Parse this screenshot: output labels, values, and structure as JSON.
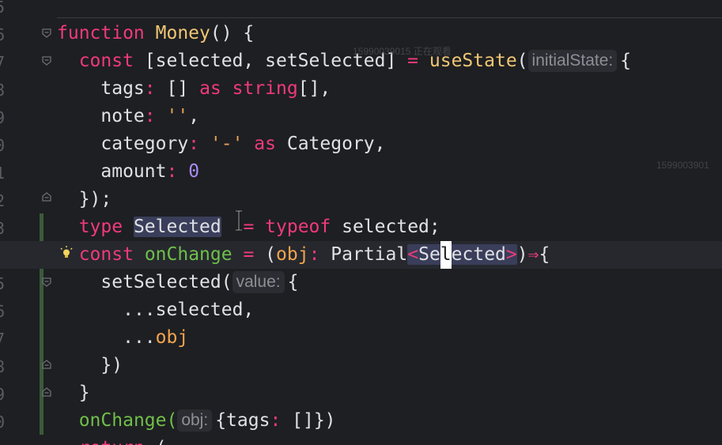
{
  "watermarks": [
    "15990039015 正在观看",
    "1599003901"
  ],
  "gutter": {
    "line_numbers": [
      "5",
      "6",
      "7",
      "8",
      "9",
      "0",
      "1",
      "2",
      "3",
      "4",
      "5",
      "6",
      "7",
      "8",
      "9",
      "0"
    ]
  },
  "code": {
    "l6": {
      "kw": "function",
      "name": "Money",
      "rest": "() {"
    },
    "l7": {
      "kw": "const",
      "a": "[selected, setSelected]",
      "eq": "=",
      "fn": "useState",
      "paren": "(",
      "hint": "initialState:",
      "brace": "{"
    },
    "l8": {
      "prop": "tags",
      "colon": ":",
      "a": "[]",
      "as": "as",
      "type": "string",
      "b": "[],"
    },
    "l9": {
      "prop": "note",
      "colon": ":",
      "str": "''",
      "b": ","
    },
    "l10": {
      "prop": "category",
      "colon": ":",
      "str": "'-'",
      "as": "as",
      "type": "Category",
      "b": ","
    },
    "l11": {
      "prop": "amount",
      "colon": ":",
      "num": "0"
    },
    "l12": {
      "text": "});"
    },
    "l13": {
      "kw": "type",
      "name": "Selected",
      "eq": "=",
      "kw2": "typeof",
      "rest": "selected;"
    },
    "l14": {
      "kw": "const",
      "name": "onChange",
      "eq": "=",
      "paren": "(",
      "param": "obj",
      "colon": ":",
      "type": "Partial",
      "lt": "<",
      "gen_a": "Se",
      "gen_caret": "l",
      "gen_b": "ected",
      "gt": ">",
      "close": ")",
      "arrow": "⇒",
      "brace": "{"
    },
    "l15": {
      "fn": "setSelected(",
      "hint": "value:",
      "brace": "{"
    },
    "l16": {
      "text": "...selected,"
    },
    "l17": {
      "dots": "...",
      "param": "obj"
    },
    "l18": {
      "text": "})"
    },
    "l19": {
      "text": "}"
    },
    "l20": {
      "fn": "onChange(",
      "hint": "obj:",
      "prop": "{tags",
      "colon": ":",
      "rest": " []})"
    },
    "l21": {
      "kw": "return",
      "rest": " ("
    }
  }
}
